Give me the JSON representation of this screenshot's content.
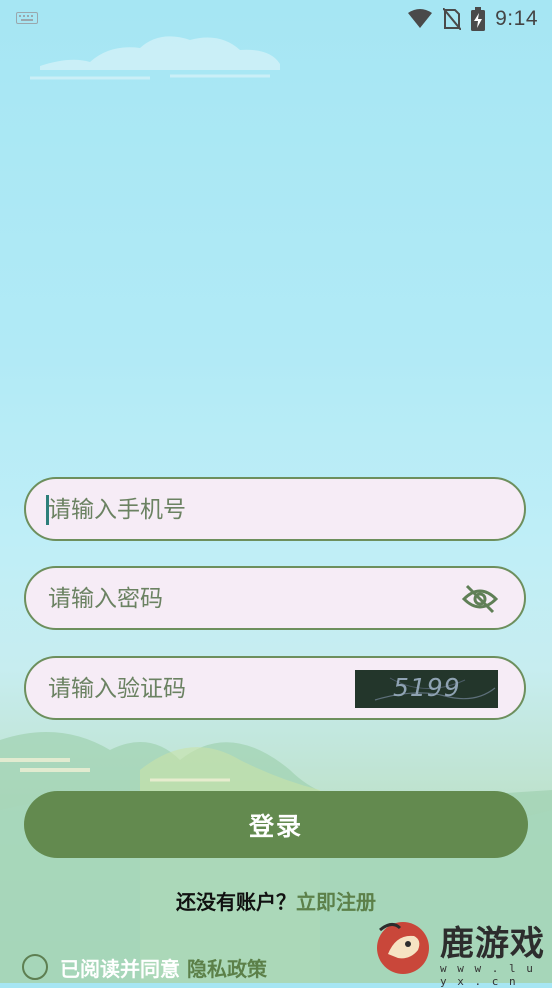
{
  "status_bar": {
    "time": "9:14",
    "icons": [
      "keyboard-icon",
      "wifi-icon",
      "no-sim-icon",
      "battery-charging-icon"
    ]
  },
  "form": {
    "phone_placeholder": "请输入手机号",
    "password_placeholder": "请输入密码",
    "captcha_placeholder": "请输入验证码",
    "captcha_text": "5199"
  },
  "login_button_label": "登录",
  "register": {
    "question": "还没有账户？",
    "link": "立即注册"
  },
  "agreement": {
    "text": "已阅读并同意",
    "policy_link": "隐私政策"
  },
  "watermark": {
    "brand": "鹿游戏",
    "url": "w w w . l u y x . c n"
  },
  "colors": {
    "primary": "#638a4f",
    "field_bg": "#f6ecf6",
    "field_border": "#6d8f5d",
    "sky": "#a6e6f3"
  }
}
